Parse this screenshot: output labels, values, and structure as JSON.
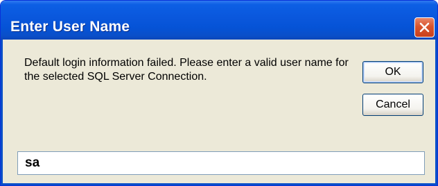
{
  "dialog": {
    "title": "Enter User Name",
    "close_icon": "close-icon",
    "message": "Default login information failed.  Please enter a valid user name for the selected SQL Server Connection.",
    "ok_label": "OK",
    "cancel_label": "Cancel",
    "username_value": "sa"
  },
  "colors": {
    "titlebar_blue": "#0a57dc",
    "close_red": "#d9542d",
    "dialog_background": "#ece9d8",
    "field_border": "#7f9db9"
  }
}
